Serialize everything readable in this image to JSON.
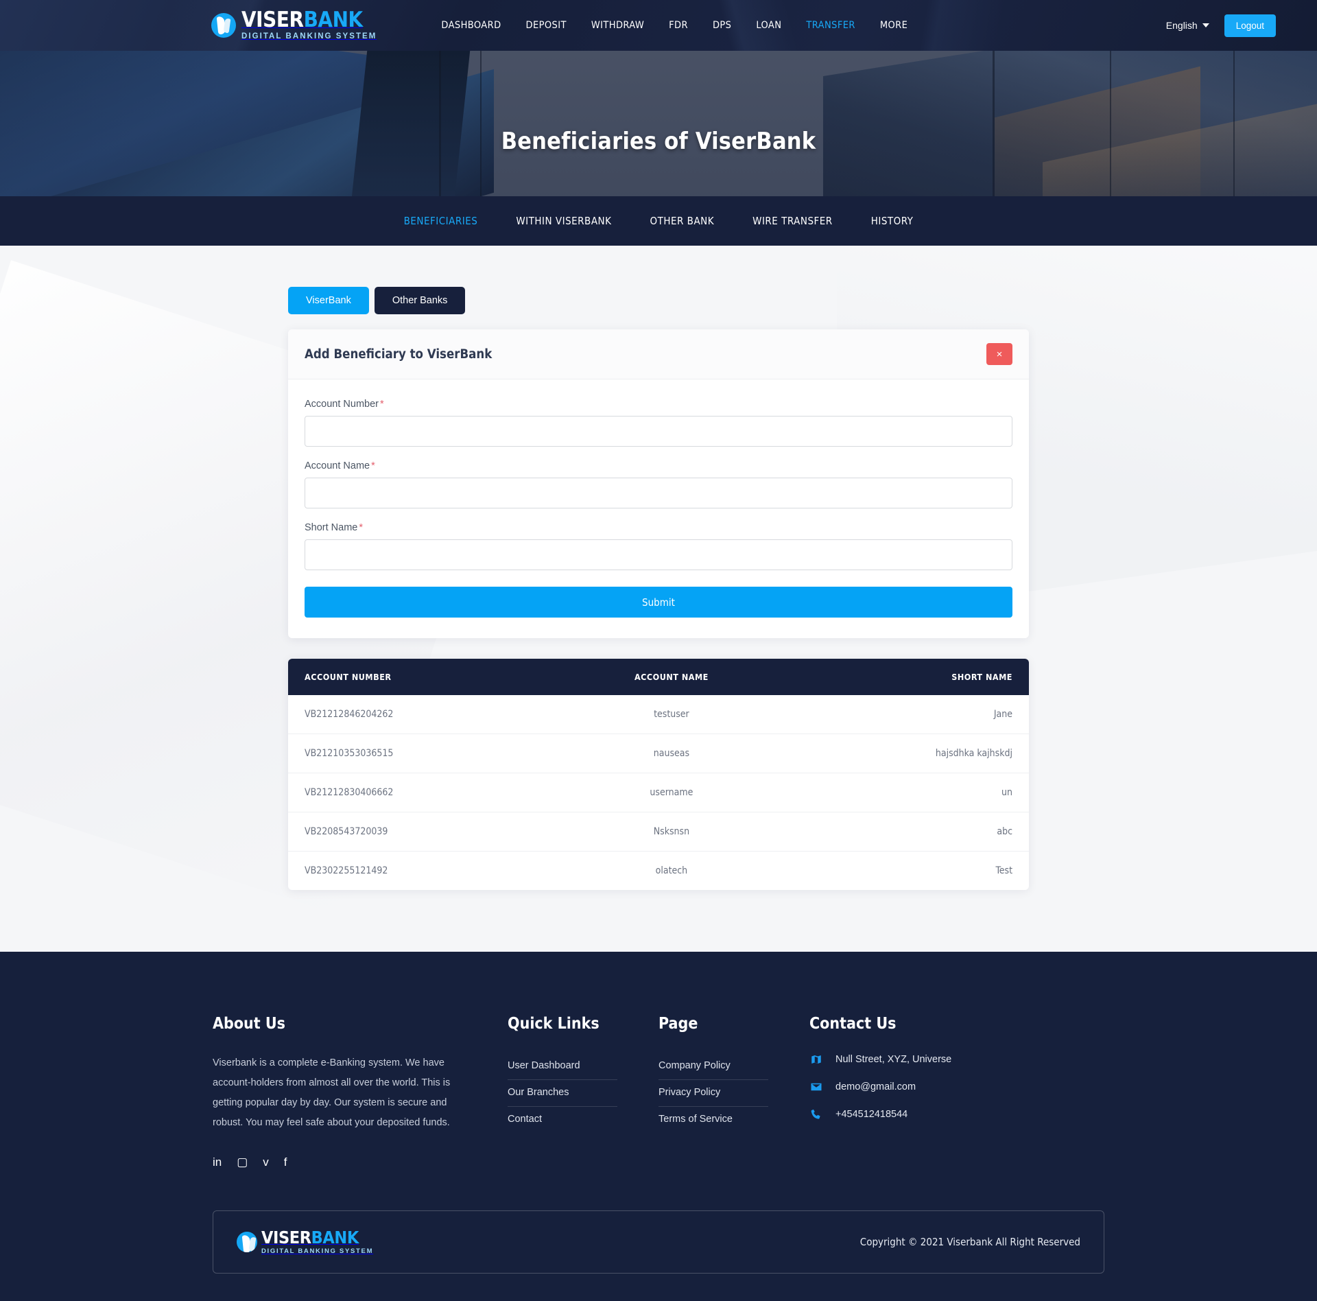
{
  "header": {
    "logo": {
      "word1": "VISER",
      "word2": "BANK",
      "tagline": "DIGITAL BANKING SYSTEM"
    },
    "menu": [
      {
        "label": "DASHBOARD",
        "active": false
      },
      {
        "label": "DEPOSIT",
        "active": false
      },
      {
        "label": "WITHDRAW",
        "active": false
      },
      {
        "label": "FDR",
        "active": false
      },
      {
        "label": "DPS",
        "active": false
      },
      {
        "label": "LOAN",
        "active": false
      },
      {
        "label": "TRANSFER",
        "active": true
      },
      {
        "label": "MORE",
        "active": false
      }
    ],
    "language": "English",
    "logout_label": "Logout"
  },
  "hero": {
    "title": "Beneficiaries of ViserBank"
  },
  "subnav": [
    {
      "label": "BENEFICIARIES",
      "active": true
    },
    {
      "label": "WITHIN VISERBANK",
      "active": false
    },
    {
      "label": "OTHER BANK",
      "active": false
    },
    {
      "label": "WIRE TRANSFER",
      "active": false
    },
    {
      "label": "HISTORY",
      "active": false
    }
  ],
  "tabs": [
    {
      "label": "ViserBank",
      "active": true
    },
    {
      "label": "Other Banks",
      "active": false
    }
  ],
  "form": {
    "title": "Add Beneficiary to ViserBank",
    "close_label": "×",
    "fields": [
      {
        "label": "Account Number",
        "required": "*",
        "value": "",
        "placeholder": ""
      },
      {
        "label": "Account Name",
        "required": "*",
        "value": "",
        "placeholder": ""
      },
      {
        "label": "Short Name",
        "required": "*",
        "value": "",
        "placeholder": ""
      }
    ],
    "submit_label": "Submit"
  },
  "table": {
    "columns": [
      "ACCOUNT NUMBER",
      "ACCOUNT NAME",
      "SHORT NAME"
    ],
    "rows": [
      {
        "account_number": "VB21212846204262",
        "account_name": "testuser",
        "short_name": "Jane"
      },
      {
        "account_number": "VB21210353036515",
        "account_name": "nauseas",
        "short_name": "hajsdhka kajhskdj"
      },
      {
        "account_number": "VB21212830406662",
        "account_name": "username",
        "short_name": "un"
      },
      {
        "account_number": "VB2208543720039",
        "account_name": "Nsksnsn",
        "short_name": "abc"
      },
      {
        "account_number": "VB2302255121492",
        "account_name": "olatech",
        "short_name": "Test"
      }
    ]
  },
  "footer": {
    "about": {
      "heading": "About Us",
      "text": "Viserbank is a complete e-Banking system. We have account-holders from almost all over the world. This is getting popular day by day. Our system is secure and robust. You may feel safe about your deposited funds.",
      "social": [
        {
          "name": "linkedin-icon",
          "glyph": "in"
        },
        {
          "name": "instagram-icon",
          "glyph": "▢"
        },
        {
          "name": "twitter-icon",
          "glyph": "ᴠ"
        },
        {
          "name": "facebook-icon",
          "glyph": "f"
        }
      ]
    },
    "quick_links": {
      "heading": "Quick Links",
      "items": [
        "User Dashboard",
        "Our Branches",
        "Contact"
      ]
    },
    "page": {
      "heading": "Page",
      "items": [
        "Company Policy",
        "Privacy Policy",
        "Terms of Service"
      ]
    },
    "contact": {
      "heading": "Contact Us",
      "address": "Null Street, XYZ, Universe",
      "email": "demo@gmail.com",
      "phone": "+454512418544"
    },
    "logo": {
      "word1": "VISER",
      "word2": "BANK",
      "tagline": "DIGITAL BANKING SYSTEM"
    },
    "copyright": "Copyright © 2021 Viserbank All Right Reserved"
  },
  "colors": {
    "accent": "#05a3f5",
    "dark": "#17203c",
    "danger": "#ef5b5b"
  }
}
